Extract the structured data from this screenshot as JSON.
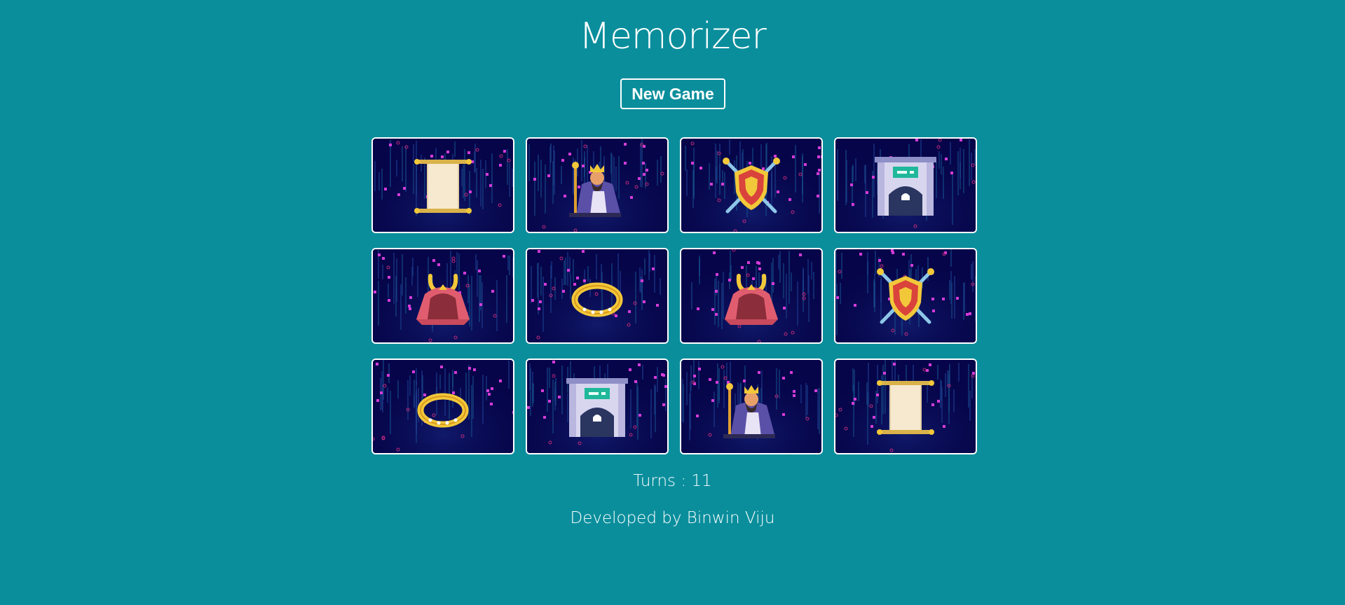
{
  "app": {
    "title": "Memorizer",
    "new_game_label": "New Game",
    "turns_label": "Turns : 11",
    "credit": "Developed by Binwin Viju"
  },
  "colors": {
    "background": "#0a8e9c",
    "card_background": "#06054a",
    "card_border": "#ffffff",
    "text": "#ffffff"
  },
  "cards": [
    {
      "icon": "scroll-icon"
    },
    {
      "icon": "king-icon"
    },
    {
      "icon": "shield-swords-icon"
    },
    {
      "icon": "gate-icon"
    },
    {
      "icon": "samurai-helmet-icon"
    },
    {
      "icon": "ring-icon"
    },
    {
      "icon": "samurai-helmet-icon"
    },
    {
      "icon": "shield-swords-icon"
    },
    {
      "icon": "ring-icon"
    },
    {
      "icon": "gate-icon"
    },
    {
      "icon": "king-icon"
    },
    {
      "icon": "scroll-icon"
    }
  ]
}
